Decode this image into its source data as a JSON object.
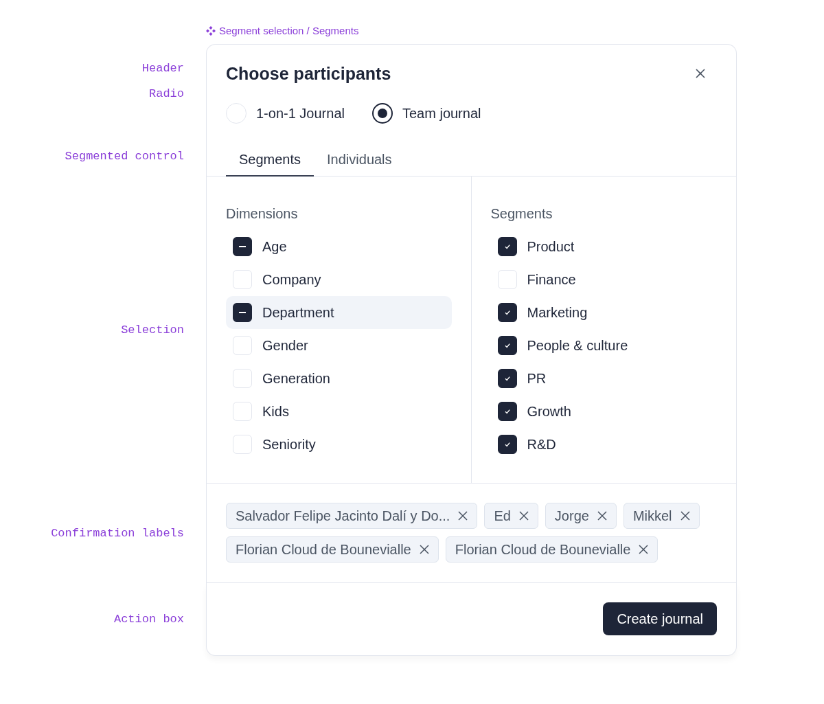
{
  "breadcrumb": {
    "text": "Segment selection / Segments"
  },
  "annotations": {
    "header": "Header",
    "radio": "Radio",
    "segmented_control": "Segmented control",
    "selection": "Selection",
    "confirmation_labels": "Confirmation labels",
    "action_box": "Action box"
  },
  "dialog": {
    "title": "Choose participants"
  },
  "radios": [
    {
      "label": "1-on-1 Journal",
      "selected": false
    },
    {
      "label": "Team journal",
      "selected": true
    }
  ],
  "tabs": [
    {
      "label": "Segments",
      "selected": true
    },
    {
      "label": "Individuals",
      "selected": false
    }
  ],
  "dimensions": {
    "title": "Dimensions",
    "items": [
      {
        "label": "Age",
        "indeterminate": true,
        "selected": false
      },
      {
        "label": "Company",
        "indeterminate": false,
        "selected": false
      },
      {
        "label": "Department",
        "indeterminate": true,
        "selected": true
      },
      {
        "label": "Gender",
        "indeterminate": false,
        "selected": false
      },
      {
        "label": "Generation",
        "indeterminate": false,
        "selected": false
      },
      {
        "label": "Kids",
        "indeterminate": false,
        "selected": false
      },
      {
        "label": "Seniority",
        "indeterminate": false,
        "selected": false
      }
    ]
  },
  "segments": {
    "title": "Segments",
    "items": [
      {
        "label": "Product",
        "checked": true
      },
      {
        "label": "Finance",
        "checked": false
      },
      {
        "label": "Marketing",
        "checked": true
      },
      {
        "label": "People & culture",
        "checked": true
      },
      {
        "label": "PR",
        "checked": true
      },
      {
        "label": "Growth",
        "checked": true
      },
      {
        "label": "R&D",
        "checked": true
      }
    ]
  },
  "tags": [
    {
      "label": "Salvador Felipe Jacinto Dalí y Do..."
    },
    {
      "label": "Ed"
    },
    {
      "label": "Jorge"
    },
    {
      "label": "Mikkel"
    },
    {
      "label": "Florian Cloud de Bounevialle"
    },
    {
      "label": "Florian Cloud de Bounevialle"
    }
  ],
  "action_button": {
    "label": "Create journal"
  }
}
